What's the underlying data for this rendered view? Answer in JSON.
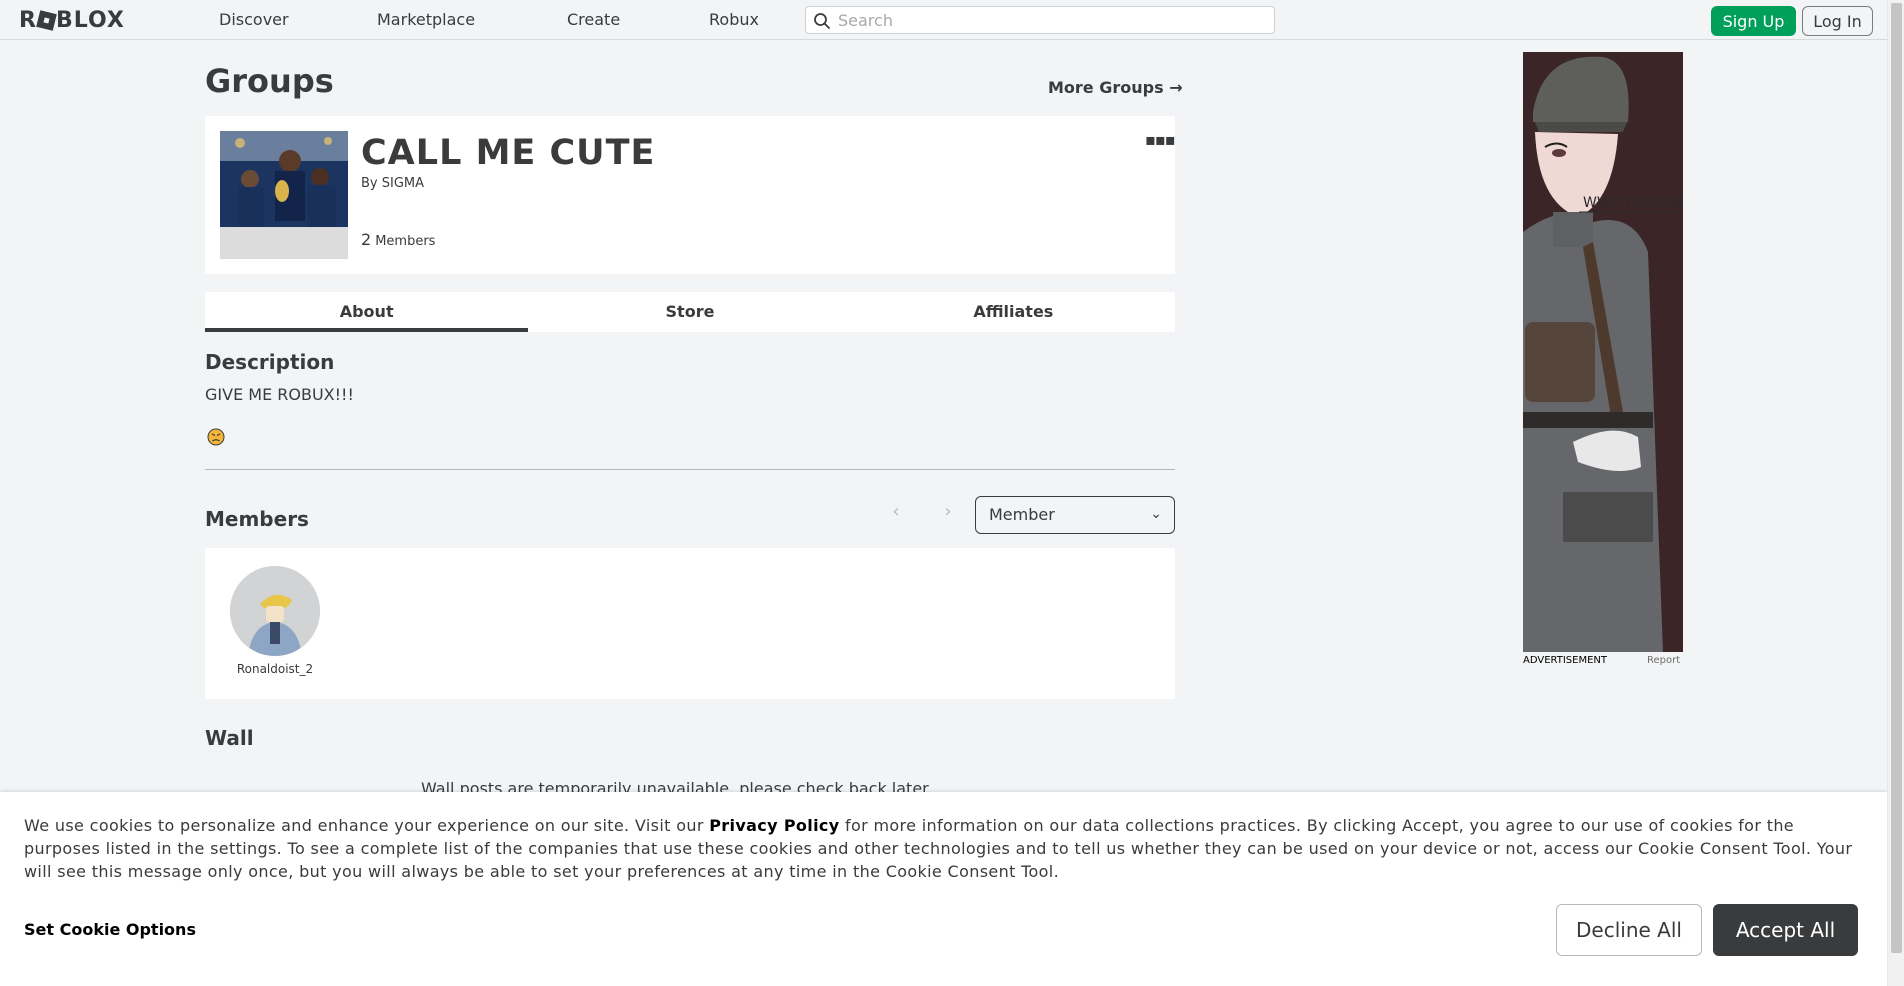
{
  "nav": {
    "logo": "ROBLOX",
    "links": [
      "Discover",
      "Marketplace",
      "Create",
      "Robux"
    ],
    "search_placeholder": "Search",
    "signup_label": "Sign Up",
    "login_label": "Log In"
  },
  "page": {
    "title": "Groups",
    "more_groups_label": "More Groups"
  },
  "group": {
    "name": "CALL ME CUTE",
    "by_label": "By",
    "owner": "SIGMA",
    "member_count": "2",
    "members_label": "Members",
    "menu_icon": "ellipsis-icon"
  },
  "tabs": [
    "About",
    "Store",
    "Affiliates"
  ],
  "active_tab": "About",
  "about": {
    "description_title": "Description",
    "description_text": "GIVE ME ROBUX!!!",
    "members_title": "Members",
    "role_filter": "Member",
    "members": [
      {
        "name": "Ronaldoist_2"
      }
    ],
    "wall_title": "Wall",
    "wall_notice": "Wall posts are temporarily unavailable, please check back later."
  },
  "ad": {
    "label": "ADVERTISEMENT",
    "report_label": "Report",
    "art_text": "WW2 TYCOON"
  },
  "cookie": {
    "text_before": "We use cookies to personalize and enhance your experience on our site. Visit our ",
    "privacy_link": "Privacy Policy",
    "text_after": " for more information on our data collections practices. By clicking Accept, you agree to our use of cookies for the purposes listed in the settings. To see a complete list of the companies that use these cookies and other technologies and to tell us whether they can be used on your device or not, access our Cookie Consent Tool. Your will see this message only once, but you will always be able to set your preferences at any time in the Cookie Consent Tool.",
    "set_options_label": "Set Cookie Options",
    "decline_label": "Decline All",
    "accept_label": "Accept All"
  },
  "colors": {
    "background": "#f2f4f5",
    "card": "#ffffff",
    "text": "#393b3d",
    "signup_green": "#00a05a",
    "accept_dark": "#393b3d"
  }
}
